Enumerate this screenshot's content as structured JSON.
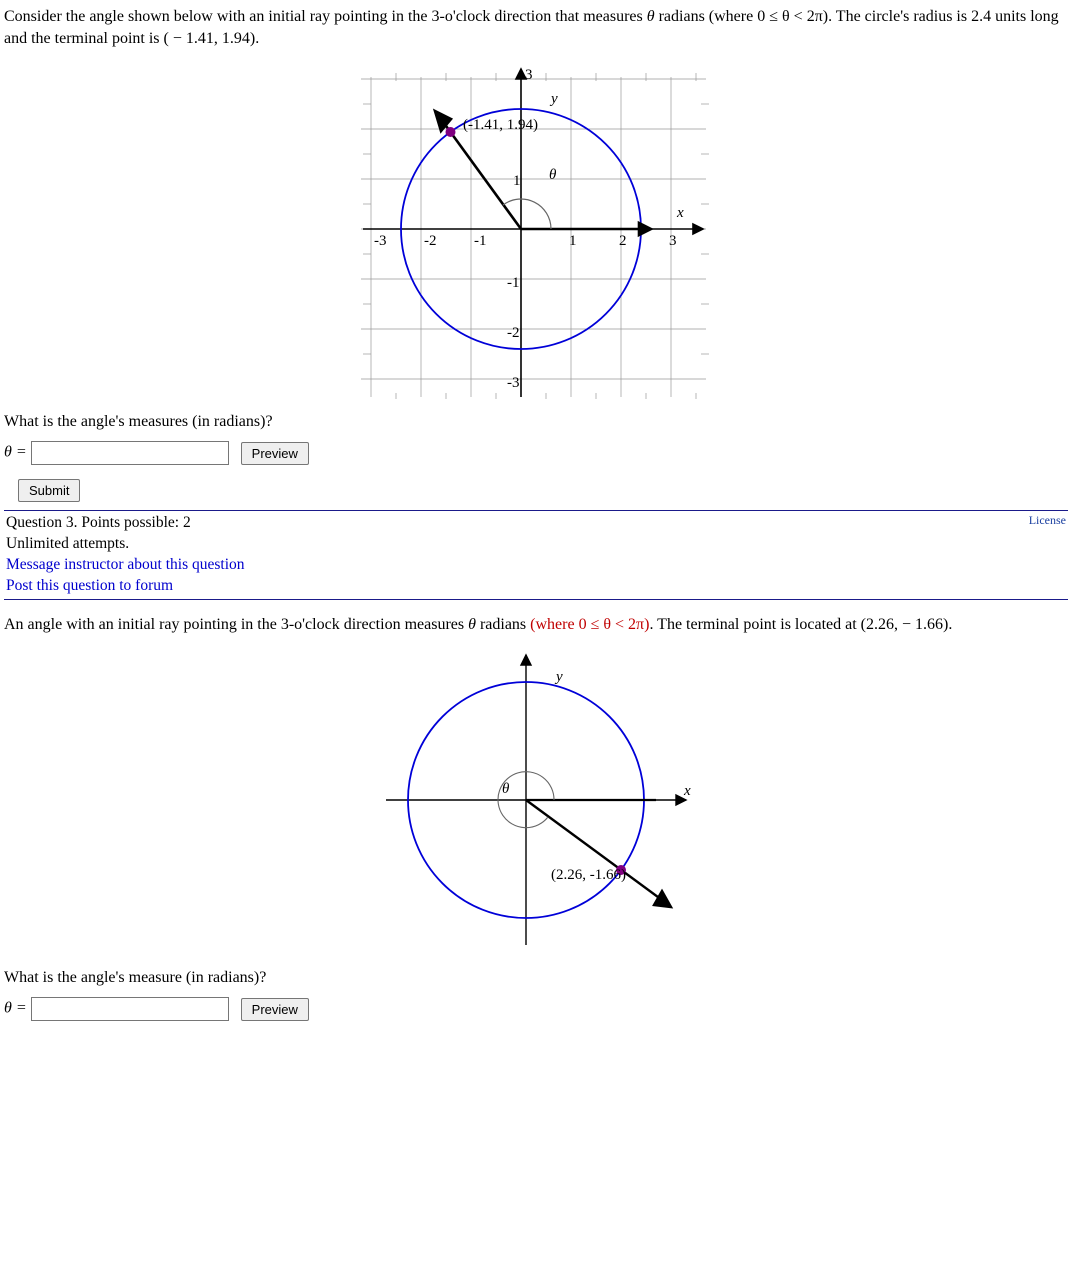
{
  "q1": {
    "problem_prefix": "Consider the angle shown below with an initial ray pointing in the 3-o'clock direction that measures ",
    "theta_txt": "θ",
    "problem_mid": " radians (where ",
    "range_txt": "0 ≤ θ < 2π",
    "problem_post": "). The circle's radius is 2.4 units long and the terminal point is ( − 1.41, 1.94).",
    "point_label": "(-1.41, 1.94)",
    "prompt": "What is the angle's measures (in radians)?",
    "theta_eq": "θ =",
    "preview_label": "Preview",
    "submit_label": "Submit",
    "meta_points": "Question 3. Points possible: 2",
    "meta_attempts": "Unlimited attempts.",
    "meta_msg": "Message instructor about this question",
    "meta_post": "Post this question to forum",
    "license": "License",
    "axis_x": "x",
    "axis_y": "y",
    "theta_graph": "θ",
    "ticks": {
      "n3": "-3",
      "n2": "-2",
      "n1": "-1",
      "p1": "1",
      "p2": "2",
      "p3": "3",
      "top": "3"
    },
    "radius": 2.4,
    "terminal_point": [
      -1.41,
      1.94
    ]
  },
  "q2": {
    "problem_a": "An angle with an initial ray pointing in the 3-o'clock direction measures ",
    "theta_txt": "θ",
    "problem_b": " radians ",
    "red_part": "(where 0 ≤ θ < 2π)",
    "problem_c": ". The terminal point is located at (2.26,  − 1.66).",
    "point_label": "(2.26, -1.66)",
    "prompt": "What is the angle's measure (in radians)?",
    "theta_eq": "θ =",
    "preview_label": "Preview",
    "axis_x": "x",
    "axis_y": "y",
    "theta_graph": "θ",
    "terminal_point": [
      2.26,
      -1.66
    ]
  },
  "chart_data": [
    {
      "type": "diagram",
      "description": "Unit-style circle on grid",
      "circle_radius": 2.4,
      "terminal_point": [
        -1.41,
        1.94
      ],
      "x_range": [
        -3,
        3
      ],
      "y_range": [
        -3,
        3
      ],
      "initial_ray": "positive x-axis",
      "angle_arc_label": "θ",
      "axis_labels": {
        "x": "x",
        "y": "y"
      },
      "point_label": "(-1.41, 1.94)"
    },
    {
      "type": "diagram",
      "description": "Circle with terminal ray in Q4",
      "terminal_point": [
        2.26,
        -1.66
      ],
      "initial_ray": "positive x-axis",
      "angle_arc_label": "θ",
      "axis_labels": {
        "x": "x",
        "y": "y"
      },
      "point_label": "(2.26, -1.66)"
    }
  ]
}
